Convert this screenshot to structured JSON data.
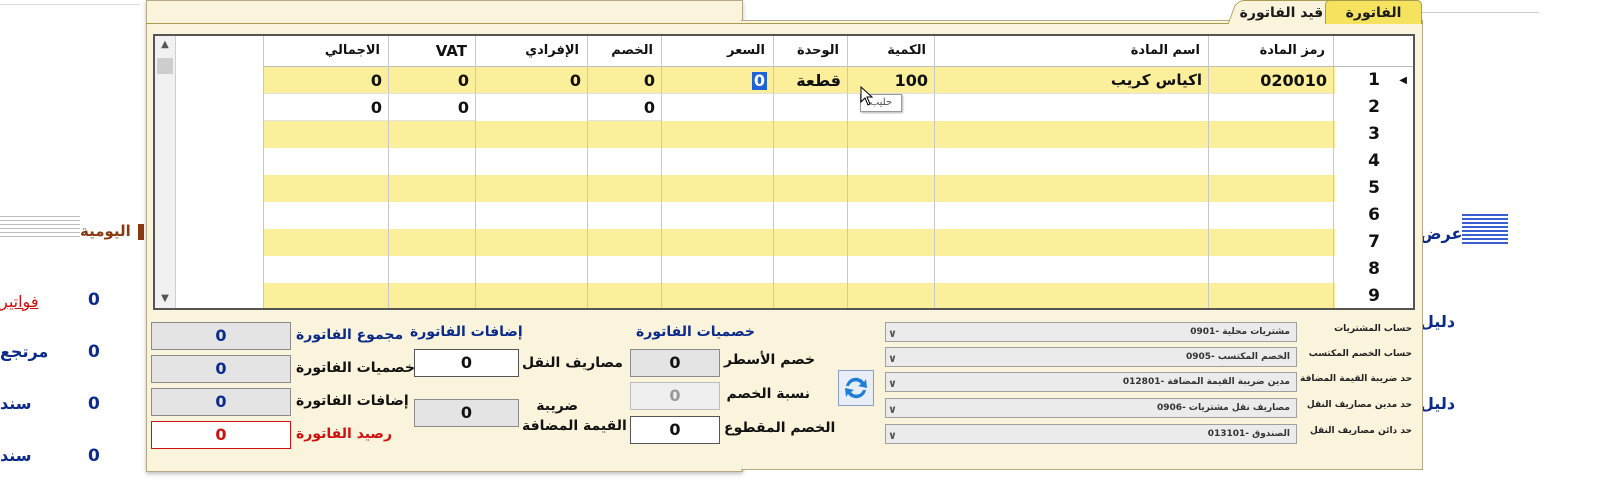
{
  "background": {
    "journal_label": "اليومية",
    "view_label": "عرض",
    "guide_label_1": "دليل",
    "guide_label_2": "دليل",
    "left_items": [
      {
        "label": "فواتير",
        "count": "0",
        "color": "red"
      },
      {
        "label": "مرتجع",
        "count": "0",
        "color": "blue"
      },
      {
        "label": "سند",
        "count": "0",
        "color": "blue"
      },
      {
        "label": "سند",
        "count": "0",
        "color": "blue"
      }
    ]
  },
  "tabs": {
    "invoice": "الفاتورة",
    "invoice_entry": "قيد الفاتورة"
  },
  "grid": {
    "columns": {
      "item_code": "رمز المادة",
      "item_name": "اسم المادة",
      "quantity": "الكمية",
      "unit": "الوحدة",
      "price": "السعر",
      "discount": "الخصم",
      "individual": "الإفرادي",
      "vat": "VAT",
      "total": "الاجمالي"
    },
    "rows": [
      {
        "num": "1",
        "item_code": "020010",
        "item_name": "اكياس كريب",
        "quantity": "100",
        "unit": "قطعة",
        "price": "0",
        "discount": "0",
        "individual": "0",
        "vat": "0",
        "total": "0"
      },
      {
        "num": "2",
        "item_code": "",
        "item_name": "",
        "quantity": "",
        "unit": "",
        "price": "",
        "discount": "0",
        "individual": "",
        "vat": "0",
        "total": "0"
      },
      {
        "num": "3"
      },
      {
        "num": "4"
      },
      {
        "num": "5"
      },
      {
        "num": "6"
      },
      {
        "num": "7"
      },
      {
        "num": "8"
      },
      {
        "num": "9"
      }
    ],
    "tooltip": "حليب"
  },
  "totals": {
    "invoice_total_label": "مجموع الفاتورة",
    "invoice_total": "0",
    "invoice_discounts_label": "خصميات الفاتورة",
    "invoice_discounts": "0",
    "invoice_additions_label": "إضافات الفاتورة",
    "invoice_additions": "0",
    "invoice_balance_label": "رصيد الفاتورة",
    "invoice_balance": "0"
  },
  "additions": {
    "title": "إضافات الفاتورة",
    "transport_label": "مصاريف النقل",
    "transport_value": "0",
    "vat_label_1": "ضريبة",
    "vat_label_2": "القيمة المضافة",
    "vat_value": "0"
  },
  "discounts": {
    "title": "خصميات الفاتورة",
    "line_discount_label": "خصم الأسطر",
    "line_discount_value": "0",
    "discount_rate_label": "نسبة الخصم",
    "discount_rate_value": "0",
    "fixed_discount_label": "الخصم المقطوع",
    "fixed_discount_value": "0"
  },
  "accounts": [
    {
      "label": "حساب المشتريات",
      "value": "مشتريات محلية  -0901"
    },
    {
      "label": "حساب الخصم المكتسب",
      "value": "الخصم المكتسب  -0905"
    },
    {
      "label": "حد ضريبة القيمة المضافة",
      "value": "مدين ضريبة القيمة المضافة  -012801"
    },
    {
      "label": "حد مدين مصاريف النقل",
      "value": "مصاريف نقل مشتريات  -0906"
    },
    {
      "label": "حد دائن مصاريف النقل",
      "value": "الصندوق  -013101"
    }
  ]
}
